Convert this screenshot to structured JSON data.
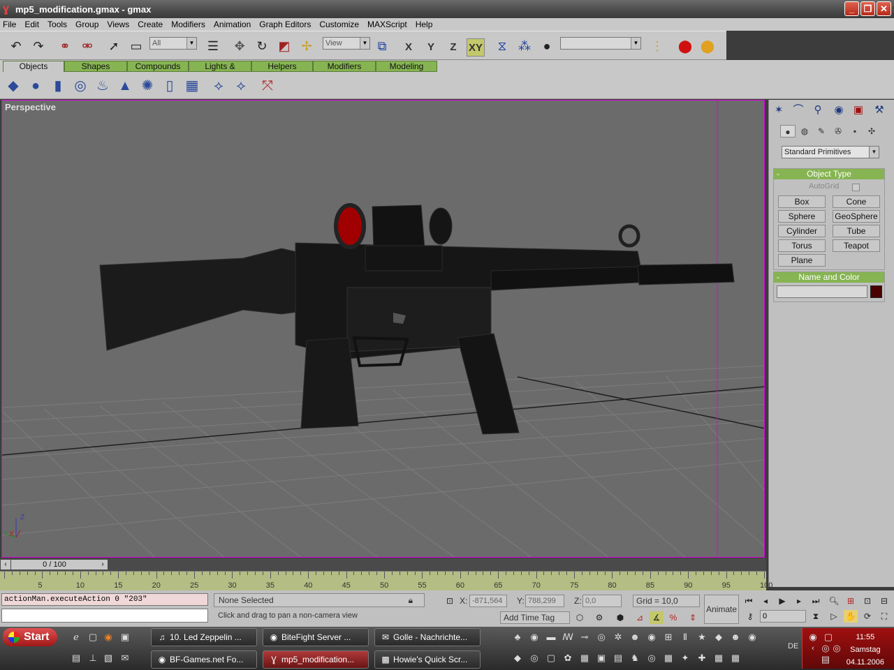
{
  "window": {
    "title": "mp5_modification.gmax - gmax",
    "controls": [
      "minimize-icon",
      "restore-icon",
      "close-icon"
    ]
  },
  "menu": [
    "File",
    "Edit",
    "Tools",
    "Group",
    "Views",
    "Create",
    "Modifiers",
    "Animation",
    "Graph Editors",
    "Customize",
    "MAXScript",
    "Help"
  ],
  "toolbar": {
    "selection_filter": "All",
    "ref_coord": "View",
    "axes": [
      "X",
      "Y",
      "Z",
      "XY"
    ],
    "active_axis": "XY",
    "named_selection": ""
  },
  "tabs": [
    "Objects",
    "Shapes",
    "Compounds",
    "Lights & Cameras",
    "Helpers",
    "Modifiers",
    "Modeling"
  ],
  "active_tab": "Objects",
  "viewport": {
    "label": "Perspective",
    "axis_labels": {
      "x": "X",
      "y": "Y",
      "z": "Z"
    }
  },
  "command_panel": {
    "category": "Standard Primitives",
    "object_type": {
      "title": "Object Type",
      "autogrid": "AutoGrid",
      "buttons": [
        "Box",
        "Cone",
        "Sphere",
        "GeoSphere",
        "Cylinder",
        "Tube",
        "Torus",
        "Teapot",
        "Plane"
      ]
    },
    "name_color": {
      "title": "Name and Color",
      "name": "",
      "color": "#4a0000"
    }
  },
  "timeline": {
    "slider_label": "0 / 100",
    "ticks": [
      "5",
      "10",
      "15",
      "20",
      "25",
      "30",
      "35",
      "40",
      "45",
      "50",
      "55",
      "60",
      "65",
      "70",
      "75",
      "80",
      "85",
      "90",
      "95",
      "100"
    ]
  },
  "status": {
    "maxscript_line": "actionMan.executeAction 0 \"203\"",
    "selection": "None Selected",
    "prompt": "Click and drag to pan a non-camera view",
    "x_label": "X:",
    "x_value": "-871,564",
    "y_label": "Y:",
    "y_value": "788,299",
    "z_label": "Z:",
    "z_value": "0,0",
    "grid": "Grid = 10,0",
    "add_time_tag": "Add Time Tag",
    "animate": "Animate",
    "frame": "0"
  },
  "taskbar": {
    "start": "Start",
    "buttons_row1": [
      "10. Led Zeppelin ...",
      "BiteFight Server ...",
      "Golle - Nachrichte..."
    ],
    "buttons_row2": [
      "BF-Games.net Fo...",
      "mp5_modification...",
      "Howie's Quick Scr..."
    ],
    "active_button": "mp5_modification...",
    "language": "DE",
    "time": "11:55",
    "day": "Samstag",
    "date": "04.11.2006"
  }
}
